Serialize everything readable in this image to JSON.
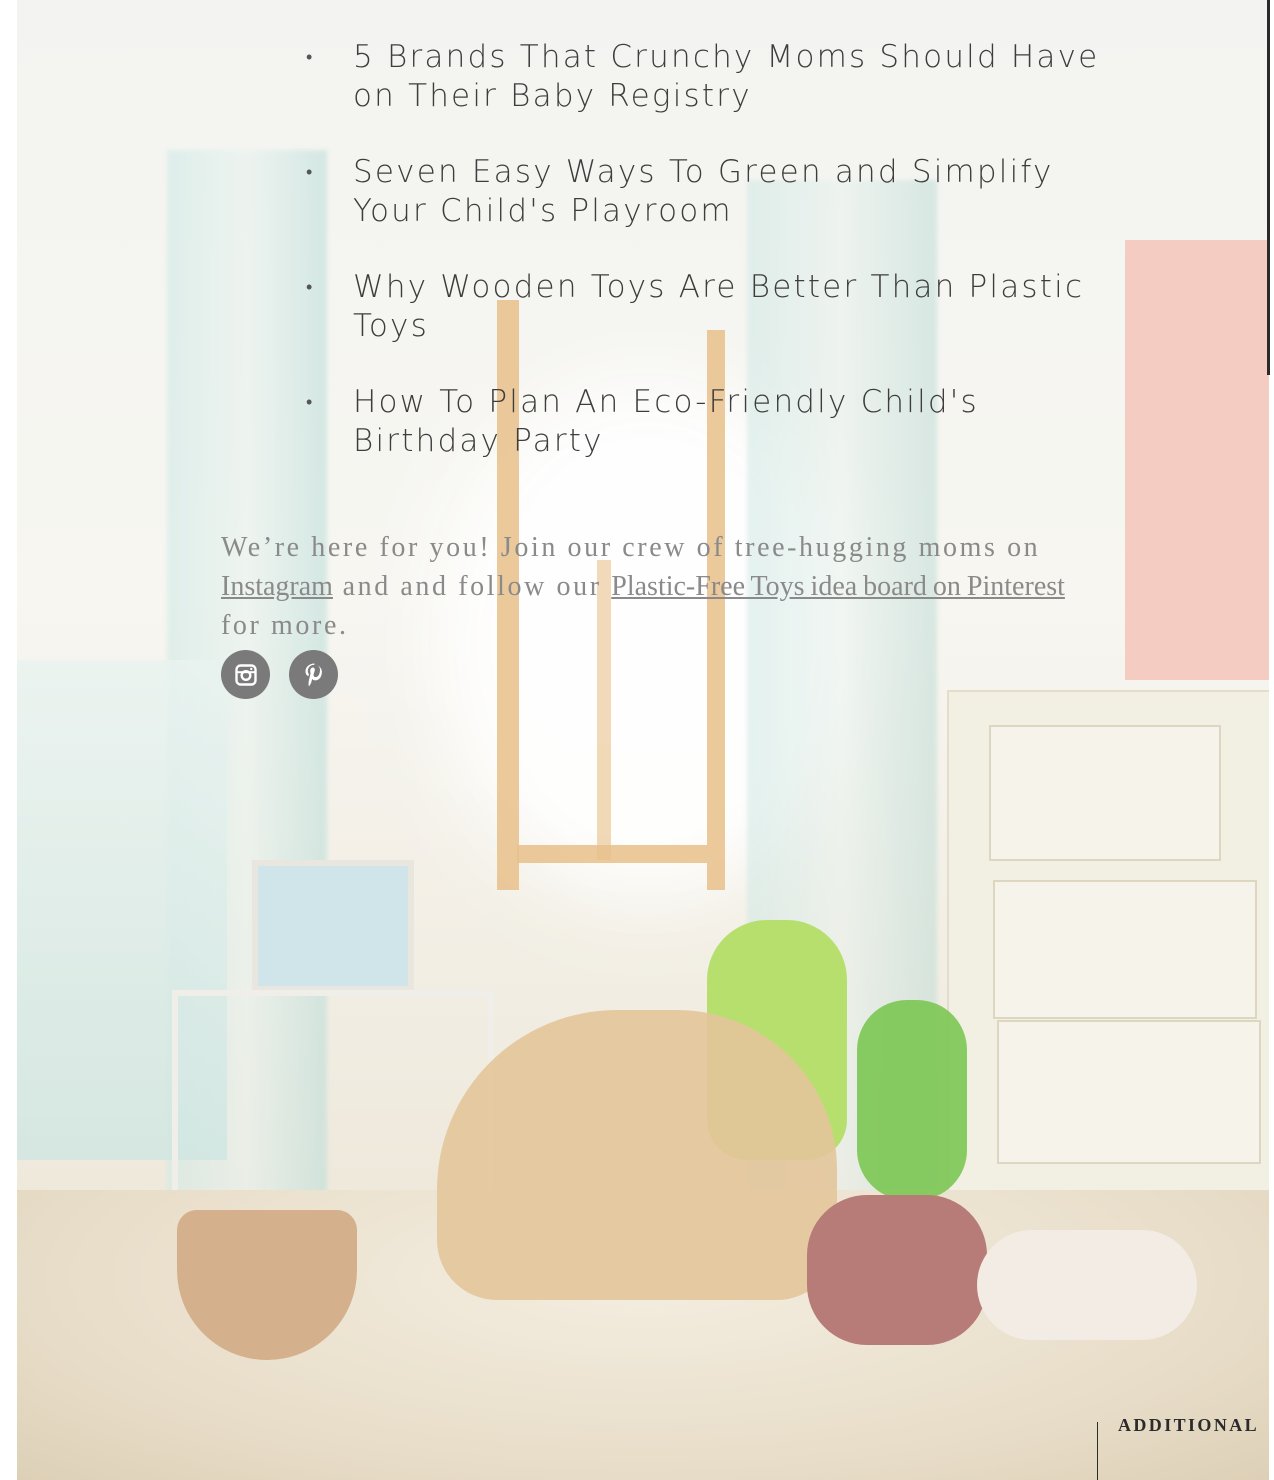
{
  "related_posts": [
    {
      "title": "5 Brands That Crunchy Moms Should Have on Their Baby Registry"
    },
    {
      "title": "Seven Easy Ways To Green and Simplify Your Child's Playroom"
    },
    {
      "title": "Why Wooden Toys Are Better Than Plastic Toys"
    },
    {
      "title": "How To Plan An Eco-Friendly Child's Birthday Party"
    }
  ],
  "bullet_char": "•",
  "cta": {
    "part1": "We’re here for you! Join our crew of tree-hugging moms on ",
    "instagram_link": "Instagram",
    "part2": " and and follow our ",
    "pinterest_link": "Plastic-Free Toys idea board on Pinterest",
    "part3": " for more."
  },
  "social": [
    {
      "name": "instagram-icon"
    },
    {
      "name": "pinterest-icon"
    }
  ],
  "section_label": "ADDITIONAL",
  "colors": {
    "text": "#3d3d3d",
    "muted": "#8a8a8a",
    "icon_bg": "#7a7a7a",
    "rule": "#2b2b2b"
  }
}
